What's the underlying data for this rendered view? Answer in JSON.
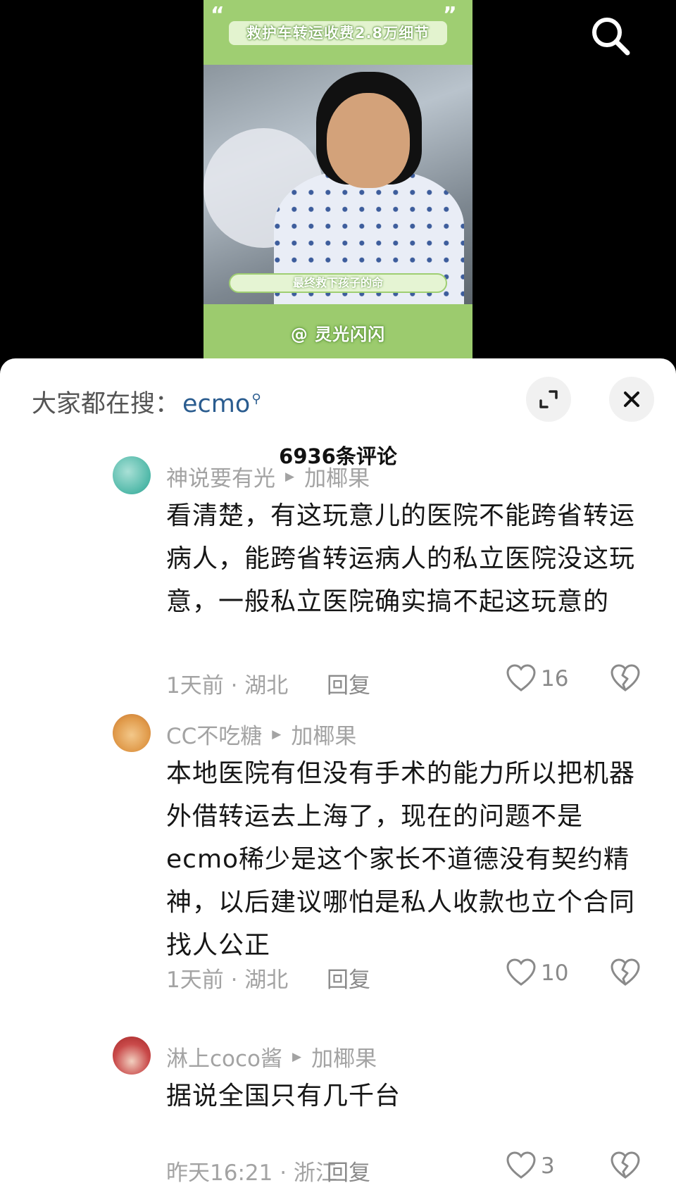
{
  "video": {
    "banner_title": "救护车转运收费2.8万细节",
    "caption": "最终救下孩子的命",
    "watermark": "@ 灵光闪闪"
  },
  "search_hint": {
    "label": "大家都在搜：",
    "keyword": "ecmo"
  },
  "comments_count": "6936条评论",
  "comments": [
    {
      "user": "神说要有光",
      "source": "加椰果",
      "text": "看清楚，有这玩意儿的医院不能跨省转运病人，能跨省转运病人的私立医院没这玩意，一般私立医院确实搞不起这玩意的",
      "time_location": "1天前 · 湖北",
      "reply": "回复",
      "likes": "16"
    },
    {
      "user": "CC不吃糖",
      "source": "加椰果",
      "text": "本地医院有但没有手术的能力所以把机器外借转运去上海了，现在的问题不是ecmo稀少是这个家长不道德没有契约精神，以后建议哪怕是私人收款也立个合同找人公正",
      "time_location": "1天前 · 湖北",
      "reply": "回复",
      "likes": "10"
    },
    {
      "user": "淋上coco酱",
      "source": "加椰果",
      "text": "据说全国只有几千台",
      "time_location": "昨天16:21 · 浙江",
      "reply": "回复",
      "likes": "3"
    }
  ],
  "colors": {
    "keyword": "#2a5c8f",
    "banner_green": "#9fce72",
    "meta_gray": "#a3a3a3"
  },
  "icons": [
    "search-icon",
    "expand-icon",
    "close-icon",
    "search-keyword-icon",
    "play-arrow-icon",
    "heart-icon",
    "broken-heart-icon"
  ]
}
